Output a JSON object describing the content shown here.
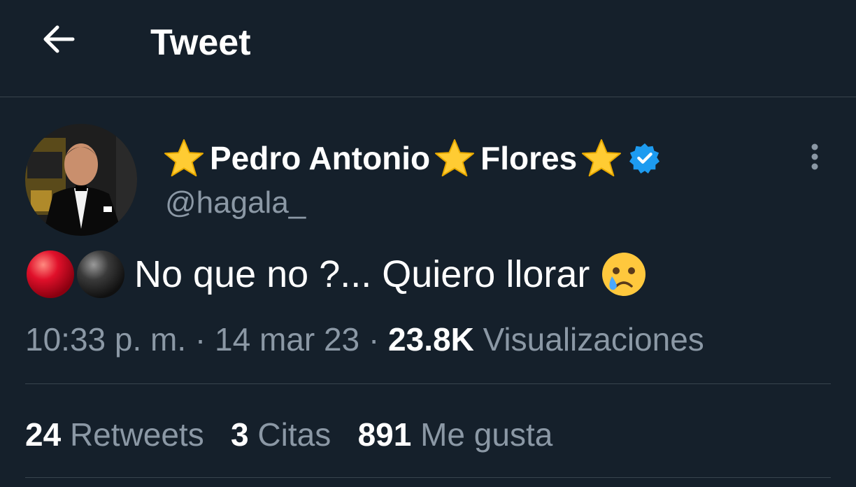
{
  "header": {
    "title": "Tweet"
  },
  "author": {
    "name_part1": "Pedro Antonio",
    "name_part2": "Flores",
    "handle": "@hagala_"
  },
  "tweet": {
    "text": "No que no ?... Quiero llorar",
    "time": "10:33 p. m.",
    "separator": "·",
    "date": "14 mar 23",
    "views_count": "23.8K",
    "views_label": "Visualizaciones"
  },
  "stats": {
    "retweets_count": "24",
    "retweets_label": "Retweets",
    "quotes_count": "3",
    "quotes_label": "Citas",
    "likes_count": "891",
    "likes_label": "Me gusta"
  },
  "colors": {
    "background": "#15202b",
    "secondary_text": "#8b98a5",
    "divider": "#38444d",
    "verified_blue": "#1d9bf0"
  },
  "icons": {
    "back": "arrow-left-icon",
    "star": "star-emoji",
    "verified": "verified-badge-icon",
    "more": "more-vertical-icon",
    "red_circle": "red-circle-emoji",
    "black_circle": "black-circle-emoji",
    "crying": "crying-face-emoji"
  }
}
